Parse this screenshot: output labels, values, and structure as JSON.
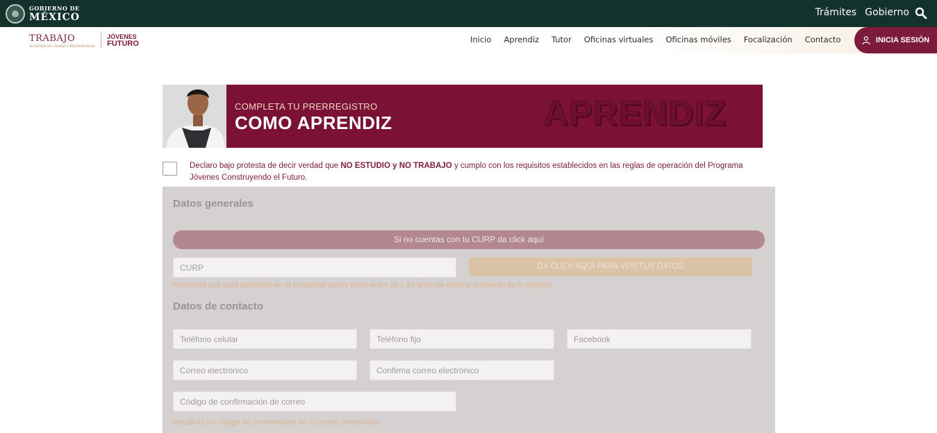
{
  "gov_bar": {
    "logo_small": "GOBIERNO DE",
    "logo_big": "MÉXICO",
    "links": [
      "Trámites",
      "Gobierno"
    ]
  },
  "nav": {
    "brand_trabajo": "TRABAJO",
    "brand_trabajo_sub": "SECRETARÍA DEL TRABAJO Y PREVISIÓN SOCIAL",
    "brand_jovenes": "JÓVENES",
    "brand_futuro": "FUTURO",
    "items": [
      "Inicio",
      "Aprendiz",
      "Tutor",
      "Oficinas virtuales",
      "Oficinas móviles",
      "Focalización",
      "Contacto"
    ],
    "login_label": "INICIA SESIÓN"
  },
  "banner": {
    "subtitle": "COMPLETA TU PRERREGISTRO",
    "title": "COMO APRENDIZ",
    "big_word": "APRENDIZ"
  },
  "declaration": {
    "part1": "Declaro bajo protesta de decir verdad que ",
    "bold": "NO ESTUDIO y NO TRABAJO",
    "part2": " y cumplo con los requisitos establecidos en las reglas de operación del Programa Jóvenes Construyendo el Futuro."
  },
  "form": {
    "general_title": "Datos generales",
    "curp_help": "Si no cuentas con tu CURP da click aquí",
    "curp_placeholder": "CURP",
    "see_data_button": "DA CLICK AQUÍ PARA VER TUS DATOS",
    "curp_note": "Recuerda que para participar en el programa debes tener entre 18 y 29 años de edad al momento de tu registro.",
    "contact_title": "Datos de contacto",
    "phone_mobile": "Teléfono celular",
    "phone_home": "Teléfono fijo",
    "facebook": "Facebook",
    "email": "Correo electrónico",
    "email_confirm": "Confirma correo electrónico",
    "code": "Código de confirmación de correo",
    "code_note": "Recibirás un código de confirmación en tu correo electrónico."
  },
  "colors": {
    "gov_green": "#13322b",
    "guinda": "#7c1b3c",
    "form_bg": "#d6d1d1"
  }
}
